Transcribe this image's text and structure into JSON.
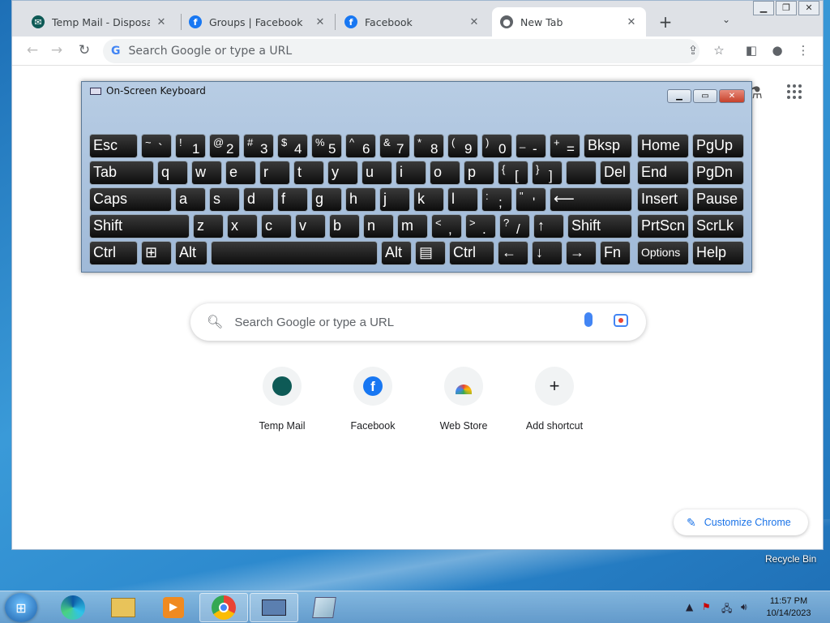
{
  "browser": {
    "tabs": [
      {
        "title": "Temp Mail - Disposable",
        "icon": "tempmail-icon"
      },
      {
        "title": "Groups | Facebook",
        "icon": "facebook-icon"
      },
      {
        "title": "Facebook",
        "icon": "facebook-icon"
      },
      {
        "title": "New Tab",
        "icon": "chrome-icon"
      }
    ],
    "omnibox_placeholder": "Search Google or type a URL"
  },
  "newtab": {
    "search_placeholder": "Search Google or type a URL",
    "shortcuts": [
      {
        "label": "Temp Mail"
      },
      {
        "label": "Facebook"
      },
      {
        "label": "Web Store"
      },
      {
        "label": "Add shortcut"
      }
    ],
    "customize_label": "Customize Chrome"
  },
  "osk": {
    "title": "On-Screen Keyboard",
    "rows": [
      [
        "Esc",
        "~|`",
        "!|1",
        "@|2",
        "#|3",
        "$|4",
        "%|5",
        "^|6",
        "&|7",
        "*|8",
        "(|9",
        ")|0",
        "_|-",
        "+|=",
        "Bksp",
        "Home",
        "PgUp"
      ],
      [
        "Tab",
        "q",
        "w",
        "e",
        "r",
        "t",
        "y",
        "u",
        "i",
        "o",
        "p",
        "{|[",
        "}|]",
        "||\\",
        "Del",
        "End",
        "PgDn"
      ],
      [
        "Caps",
        "a",
        "s",
        "d",
        "f",
        "g",
        "h",
        "j",
        "k",
        "l",
        ":|;",
        "\"|'",
        "⟵",
        "Insert",
        "Pause"
      ],
      [
        "Shift",
        "z",
        "x",
        "c",
        "v",
        "b",
        "n",
        "m",
        "<|,",
        ">|.",
        "?|/",
        "↑",
        "Shift",
        "PrtScn",
        "ScrLk"
      ],
      [
        "Ctrl",
        "⊞",
        "Alt",
        "",
        "Alt",
        "▤",
        "Ctrl",
        "←",
        "↓",
        "→",
        "Fn",
        "Options",
        "Help"
      ]
    ]
  },
  "desktop": {
    "recycle_bin": "Recycle Bin"
  },
  "taskbar": {
    "time": "11:57 PM",
    "date": "10/14/2023"
  }
}
